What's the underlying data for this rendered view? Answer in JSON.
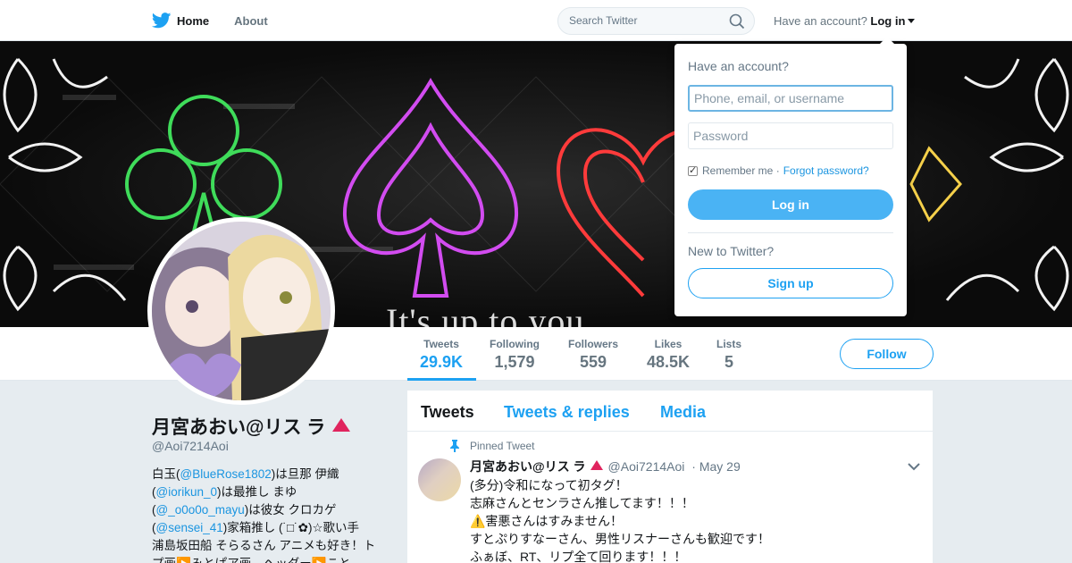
{
  "nav": {
    "home_label": "Home",
    "about_label": "About",
    "search_placeholder": "Search Twitter",
    "have_account_text": "Have an account?",
    "login_label": "Log in"
  },
  "banner": {
    "caption": "It's up to you"
  },
  "profile": {
    "name": "月宮あおい@リス ラ",
    "handle": "@Aoi7214Aoi",
    "follow_label": "Follow",
    "bio": {
      "line1_pre": "白玉(",
      "mention1": "@BlueRose1802",
      "line1_post": ")は旦那 伊織",
      "line2_pre": "(",
      "mention2": "@iorikun_0",
      "line2_post": ")は最推し まゆ",
      "line3_pre": "(",
      "mention3": "@_o0o0o_mayu",
      "line3_post": ")は彼女 クロカゲ",
      "line4_pre": "(",
      "mention4": "@sensei_41",
      "line4_post": ")家箱推し (˙□˙✿)☆歌い手",
      "line5": "浦島坂田船 そらるさん アニメも好き！ト",
      "line6": "プ画▶️みとぱア画→ヘッダー▶️こと"
    }
  },
  "stats": [
    {
      "label": "Tweets",
      "value": "29.9K"
    },
    {
      "label": "Following",
      "value": "1,579"
    },
    {
      "label": "Followers",
      "value": "559"
    },
    {
      "label": "Likes",
      "value": "48.5K"
    },
    {
      "label": "Lists",
      "value": "5"
    }
  ],
  "tabs": [
    "Tweets",
    "Tweets & replies",
    "Media"
  ],
  "tweet": {
    "pinned_label": "Pinned Tweet",
    "name": "月宮あおい@リス ラ",
    "handle": "@Aoi7214Aoi",
    "date": "· May 29",
    "lines": [
      "(多分)令和になって初タグ！",
      "志麻さんとセンラさん推してます！！！",
      "⚠️害悪さんはすみません！",
      "すとぷりすなーさん、男性リスナーさんも歓迎です！",
      "ふぁぼ、RT、リプ全て回ります！！！"
    ]
  },
  "login_dropdown": {
    "title": "Have an account?",
    "username_placeholder": "Phone, email, or username",
    "password_placeholder": "Password",
    "remember_label": "Remember me ·",
    "forgot_label": "Forgot password?",
    "login_button": "Log in",
    "new_prompt": "New to Twitter?",
    "signup_button": "Sign up"
  },
  "colors": {
    "accent": "#1da1f2",
    "login_button": "#4ab3f4",
    "badge_triangle": "#e0245e"
  }
}
